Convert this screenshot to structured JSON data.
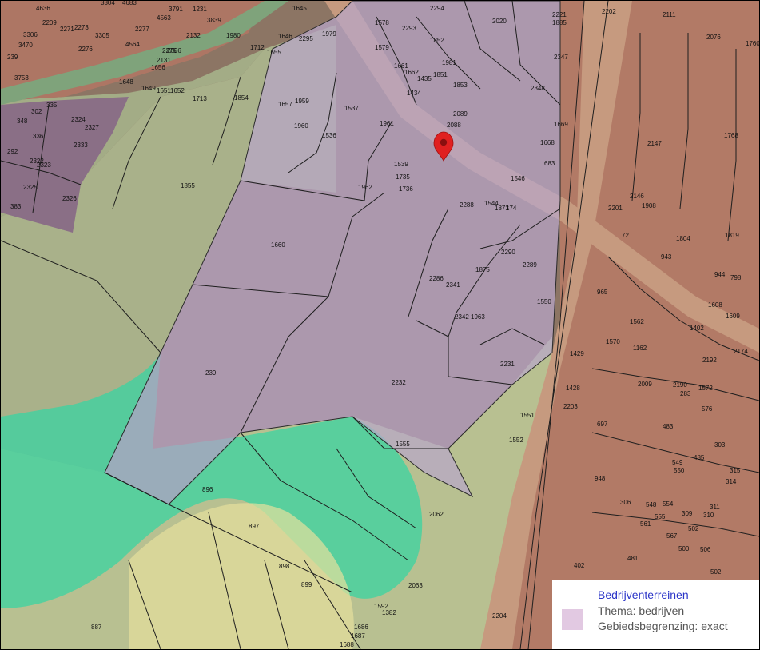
{
  "legend": {
    "title": "Bedrijventerreinen",
    "theme": "Thema: bedrijven",
    "boundary": "Gebiedsbegrenzing: exact",
    "swatch_color": "#e2c9e2"
  },
  "map": {
    "marker_icon": "map-pin-icon",
    "marker_color": "#e02020",
    "business_area_color": "#b9a6c9",
    "green_zone_color": "#3ad4a2",
    "parcel_labels": [
      {
        "text": "4636"
      },
      {
        "text": "3304"
      },
      {
        "text": "4683"
      },
      {
        "text": "3791"
      },
      {
        "text": "1231"
      },
      {
        "text": "1645"
      },
      {
        "text": "2294"
      },
      {
        "text": "2202"
      },
      {
        "text": "2111"
      },
      {
        "text": "2209"
      },
      {
        "text": "2271"
      },
      {
        "text": "2273"
      },
      {
        "text": "4563"
      },
      {
        "text": "3839"
      },
      {
        "text": "3306"
      },
      {
        "text": "3305"
      },
      {
        "text": "2277"
      },
      {
        "text": "2132"
      },
      {
        "text": "1980"
      },
      {
        "text": "1646"
      },
      {
        "text": "2295"
      },
      {
        "text": "1979"
      },
      {
        "text": "1578"
      },
      {
        "text": "2293"
      },
      {
        "text": "2020"
      },
      {
        "text": "2221"
      },
      {
        "text": "1885"
      },
      {
        "text": "2076"
      },
      {
        "text": "1760"
      },
      {
        "text": "3470"
      },
      {
        "text": "2276"
      },
      {
        "text": "4564"
      },
      {
        "text": "2275"
      },
      {
        "text": "1712"
      },
      {
        "text": "1655"
      },
      {
        "text": "1852"
      },
      {
        "text": "1579"
      },
      {
        "text": "2347"
      },
      {
        "text": "239"
      },
      {
        "text": "2006"
      },
      {
        "text": "2131"
      },
      {
        "text": "1656"
      },
      {
        "text": "1981"
      },
      {
        "text": "1661"
      },
      {
        "text": "1662"
      },
      {
        "text": "1851"
      },
      {
        "text": "1435"
      },
      {
        "text": "3753"
      },
      {
        "text": "1648"
      },
      {
        "text": "1649"
      },
      {
        "text": "1651"
      },
      {
        "text": "1652"
      },
      {
        "text": "1713"
      },
      {
        "text": "1854"
      },
      {
        "text": "1657"
      },
      {
        "text": "1959"
      },
      {
        "text": "1537"
      },
      {
        "text": "1434"
      },
      {
        "text": "1853"
      },
      {
        "text": "2348"
      },
      {
        "text": "2089"
      },
      {
        "text": "348"
      },
      {
        "text": "302"
      },
      {
        "text": "335"
      },
      {
        "text": "2324"
      },
      {
        "text": "2327"
      },
      {
        "text": "1960"
      },
      {
        "text": "1961"
      },
      {
        "text": "2088"
      },
      {
        "text": "1669"
      },
      {
        "text": "1768"
      },
      {
        "text": "336"
      },
      {
        "text": "2333"
      },
      {
        "text": "1536"
      },
      {
        "text": "1668"
      },
      {
        "text": "2147"
      },
      {
        "text": "292"
      },
      {
        "text": "2322"
      },
      {
        "text": "2323"
      },
      {
        "text": "683"
      },
      {
        "text": "1539"
      },
      {
        "text": "1735"
      },
      {
        "text": "1546"
      },
      {
        "text": "1855"
      },
      {
        "text": "1962"
      },
      {
        "text": "1736"
      },
      {
        "text": "2325"
      },
      {
        "text": "2326"
      },
      {
        "text": "383"
      },
      {
        "text": "2288"
      },
      {
        "text": "1544"
      },
      {
        "text": "1873"
      },
      {
        "text": "174"
      },
      {
        "text": "2146"
      },
      {
        "text": "1908"
      },
      {
        "text": "2201"
      },
      {
        "text": "1660"
      },
      {
        "text": "1819"
      },
      {
        "text": "2290"
      },
      {
        "text": "2289"
      },
      {
        "text": "1875"
      },
      {
        "text": "72"
      },
      {
        "text": "1804"
      },
      {
        "text": "943"
      },
      {
        "text": "944"
      },
      {
        "text": "798"
      },
      {
        "text": "2286"
      },
      {
        "text": "2341"
      },
      {
        "text": "965"
      },
      {
        "text": "1550"
      },
      {
        "text": "1608"
      },
      {
        "text": "1609"
      },
      {
        "text": "2342"
      },
      {
        "text": "1963"
      },
      {
        "text": "1562"
      },
      {
        "text": "1162"
      },
      {
        "text": "1402"
      },
      {
        "text": "2174"
      },
      {
        "text": "239"
      },
      {
        "text": "1429"
      },
      {
        "text": "1570"
      },
      {
        "text": "2231"
      },
      {
        "text": "2192"
      },
      {
        "text": "2232"
      },
      {
        "text": "1428"
      },
      {
        "text": "2009"
      },
      {
        "text": "2190"
      },
      {
        "text": "283"
      },
      {
        "text": "1572"
      },
      {
        "text": "576"
      },
      {
        "text": "1551"
      },
      {
        "text": "697"
      },
      {
        "text": "483"
      },
      {
        "text": "1555"
      },
      {
        "text": "1552"
      },
      {
        "text": "303"
      },
      {
        "text": "485"
      },
      {
        "text": "549"
      },
      {
        "text": "550"
      },
      {
        "text": "315"
      },
      {
        "text": "896"
      },
      {
        "text": "948"
      },
      {
        "text": "314"
      },
      {
        "text": "2062"
      },
      {
        "text": "306"
      },
      {
        "text": "548"
      },
      {
        "text": "554"
      },
      {
        "text": "309"
      },
      {
        "text": "311"
      },
      {
        "text": "310"
      },
      {
        "text": "897"
      },
      {
        "text": "555"
      },
      {
        "text": "502"
      },
      {
        "text": "561"
      },
      {
        "text": "567"
      },
      {
        "text": "506"
      },
      {
        "text": "500"
      },
      {
        "text": "898"
      },
      {
        "text": "481"
      },
      {
        "text": "502"
      },
      {
        "text": "402"
      },
      {
        "text": "899"
      },
      {
        "text": "2063"
      },
      {
        "text": "2204"
      },
      {
        "text": "887"
      },
      {
        "text": "1686"
      },
      {
        "text": "1687"
      },
      {
        "text": "1688"
      },
      {
        "text": "2203"
      },
      {
        "text": "1382"
      },
      {
        "text": "1592"
      }
    ]
  }
}
